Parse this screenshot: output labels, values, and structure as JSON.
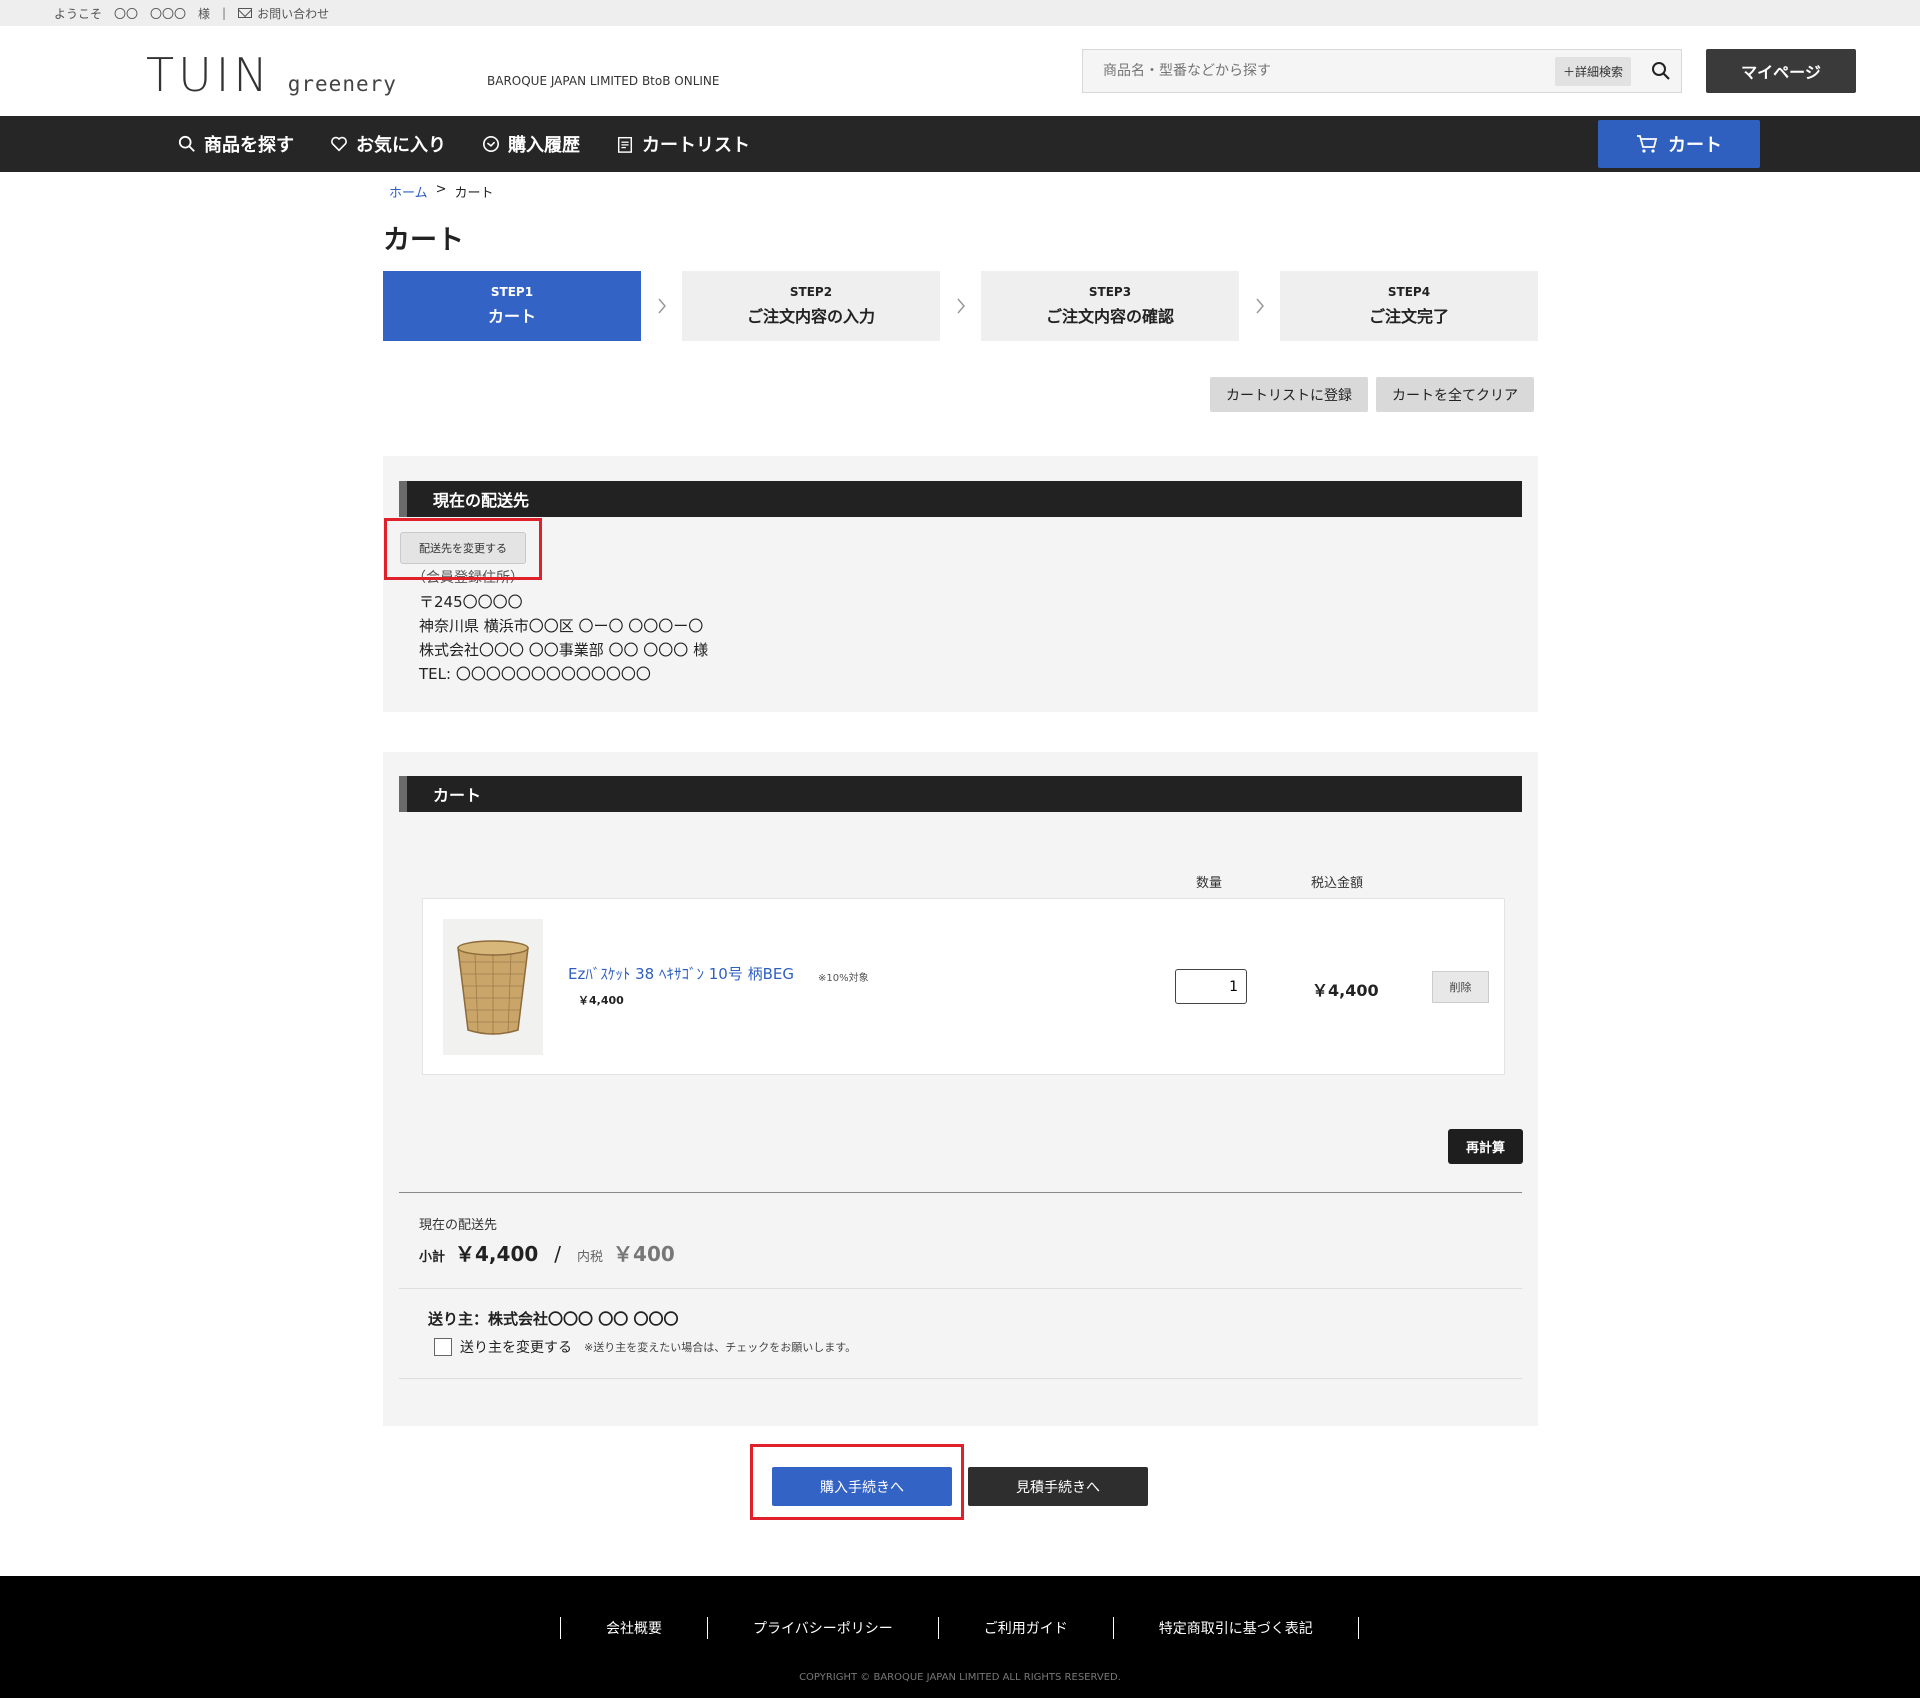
{
  "topbar": {
    "welcome": "ようこそ　〇〇　〇〇〇　様",
    "separator": "|",
    "contact": "お問い合わせ"
  },
  "header": {
    "logo_main": "TUIN",
    "logo_sub": "greenery",
    "brand_line": "BAROQUE JAPAN LIMITED BtoB ONLINE",
    "search_placeholder": "商品名・型番などから探す",
    "advanced_search": "＋詳細検索",
    "mypage": "マイページ"
  },
  "nav": {
    "items": [
      {
        "label": "商品を探す",
        "icon": "search-icon"
      },
      {
        "label": "お気に入り",
        "icon": "heart-icon"
      },
      {
        "label": "購入履歴",
        "icon": "history-icon"
      },
      {
        "label": "カートリスト",
        "icon": "clipboard-icon"
      }
    ],
    "cart": "カート"
  },
  "breadcrumb": {
    "home": "ホーム",
    "sep": ">",
    "current": "カート"
  },
  "page_title": "カート",
  "steps": [
    {
      "num": "STEP1",
      "label": "カート",
      "active": true
    },
    {
      "num": "STEP2",
      "label": "ご注文内容の入力",
      "active": false
    },
    {
      "num": "STEP3",
      "label": "ご注文内容の確認",
      "active": false
    },
    {
      "num": "STEP4",
      "label": "ご注文完了",
      "active": false
    }
  ],
  "actions": {
    "register_cartlist": "カートリストに登録",
    "clear_cart": "カートを全てクリア"
  },
  "shipping": {
    "heading": "現在の配送先",
    "change_button": "配送先を変更する",
    "type": "（会員登録住所）",
    "postal": "〒245〇〇〇〇",
    "address": "神奈川県 横浜市〇〇区 〇ー〇 〇〇〇ー〇",
    "name": "株式会社〇〇〇 〇〇事業部 〇〇 〇〇〇 様",
    "tel": "TEL: 〇〇〇〇〇〇〇〇〇〇〇〇〇"
  },
  "cart": {
    "heading": "カート",
    "col_qty": "数量",
    "col_total": "税込金額",
    "items": [
      {
        "name": "Ezﾊﾞｽｹｯﾄ 38 ﾍｷｻｺﾞﾝ 10号 柄BEG",
        "tax_note": "※10%対象",
        "unit_price": "￥4,400",
        "qty": "1",
        "total": "￥4,400",
        "delete": "削除"
      }
    ],
    "recalc": "再計算",
    "summary_label": "現在の配送先",
    "subtotal_label": "小計",
    "subtotal": "￥4,400",
    "slash": "/",
    "tax_label": "内税",
    "tax": "￥400",
    "sender_label": "送り主：株式会社〇〇〇 〇〇 〇〇〇",
    "change_sender": "送り主を変更する",
    "sender_note": "※送り主を変えたい場合は、チェックをお願いします。"
  },
  "buttons": {
    "checkout": "購入手続きへ",
    "quote": "見積手続きへ"
  },
  "footer": {
    "links": [
      "会社概要",
      "プライバシーポリシー",
      "ご利用ガイド",
      "特定商取引に基づく表記"
    ],
    "copyright": "COPYRIGHT © BAROQUE JAPAN LIMITED ALL RIGHTS RESERVED."
  },
  "colors": {
    "accent": "#3463c6",
    "nav_bg": "#262626",
    "highlight": "#e0202a"
  }
}
